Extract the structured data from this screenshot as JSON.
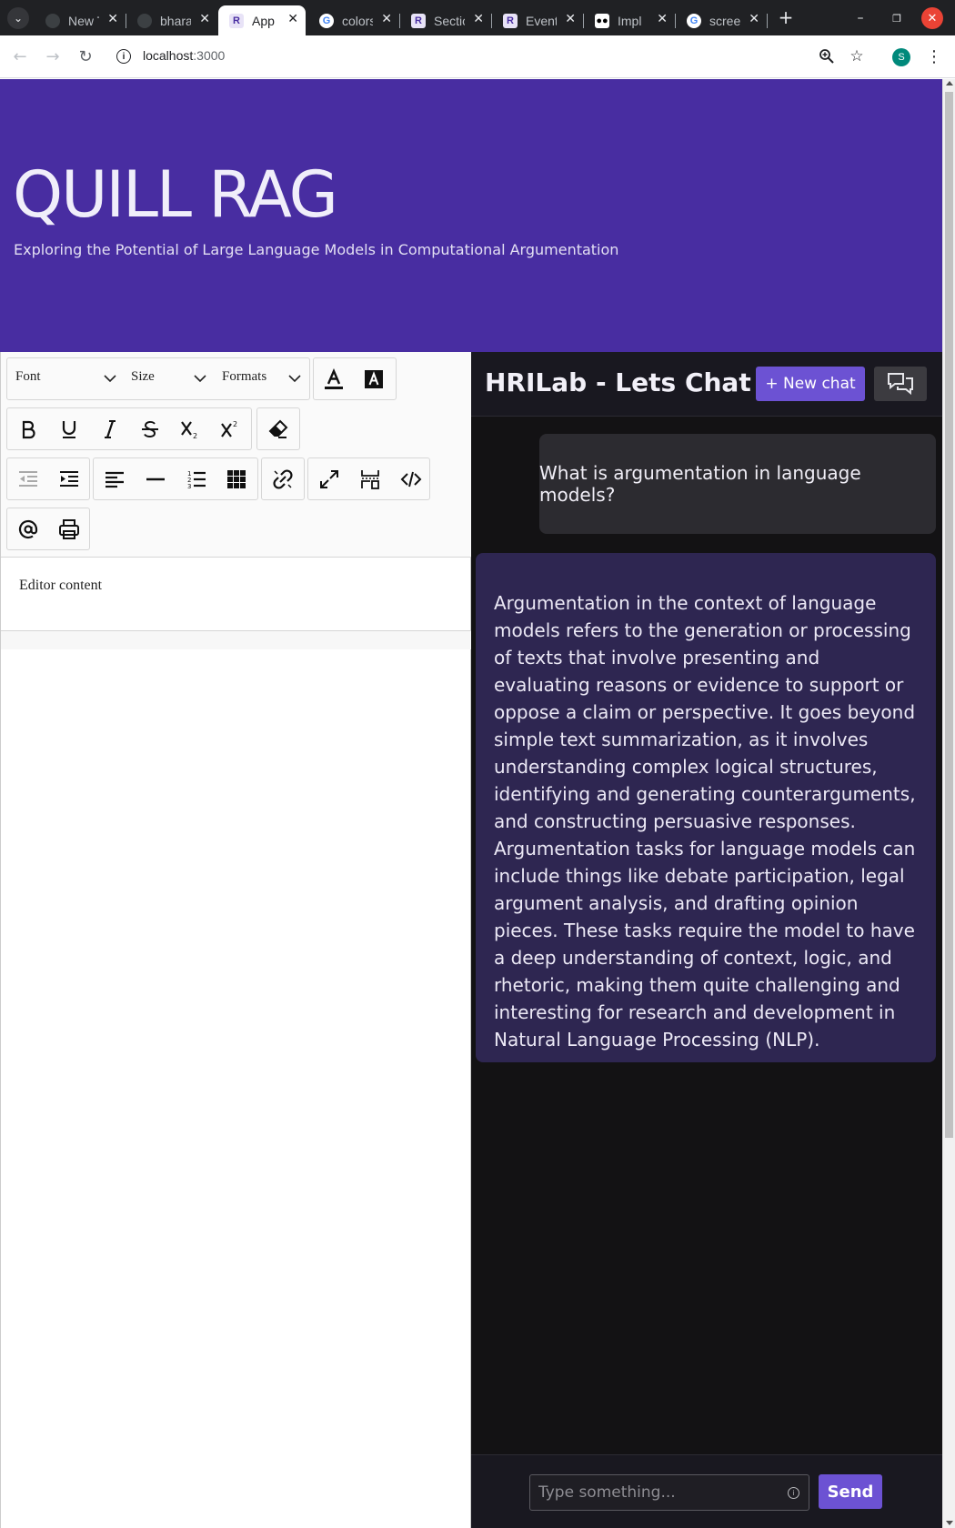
{
  "browser": {
    "tabs": [
      {
        "title": "New Tab",
        "favicon": "chrome-icon"
      },
      {
        "title": "bharat",
        "favicon": "github-icon"
      },
      {
        "title": "App",
        "favicon": "r-icon",
        "active": true
      },
      {
        "title": "colors",
        "favicon": "google-icon"
      },
      {
        "title": "Section",
        "favicon": "r-icon"
      },
      {
        "title": "Events",
        "favicon": "r-icon"
      },
      {
        "title": "Impl",
        "favicon": "medium-icon"
      },
      {
        "title": "screen",
        "favicon": "google-icon"
      }
    ],
    "url_host": "localhost",
    "url_port": ":3000",
    "profile_initial": "S"
  },
  "hero": {
    "title": "QUILL RAG",
    "subtitle": "Exploring the Potential of Large Language Models in Computational Argumentation",
    "bg_color": "#482da1"
  },
  "editor": {
    "font_picker": "Font",
    "size_picker": "Size",
    "formats_picker": "Formats",
    "content": "Editor content"
  },
  "chat": {
    "title": "HRILab - Lets Chat",
    "new_chat_label": "+ New chat",
    "messages": [
      {
        "role": "user",
        "text": "What is argumentation in language models?"
      },
      {
        "role": "assistant",
        "text": "Argumentation in the context of language models refers to the generation or processing of texts that involve presenting and evaluating reasons or evidence to support or oppose a claim or perspective. It goes beyond simple text summarization, as it involves understanding complex logical structures, identifying and generating counterarguments, and constructing persuasive responses. Argumentation tasks for language models can include things like debate participation, legal argument analysis, and drafting opinion pieces. These tasks require the model to have a deep understanding of context, logic, and rhetoric, making them quite challenging and interesting for research and development in Natural Language Processing (NLP)."
      }
    ],
    "input_placeholder": "Type something...",
    "send_label": "Send",
    "accent_color": "#6c52d3"
  }
}
